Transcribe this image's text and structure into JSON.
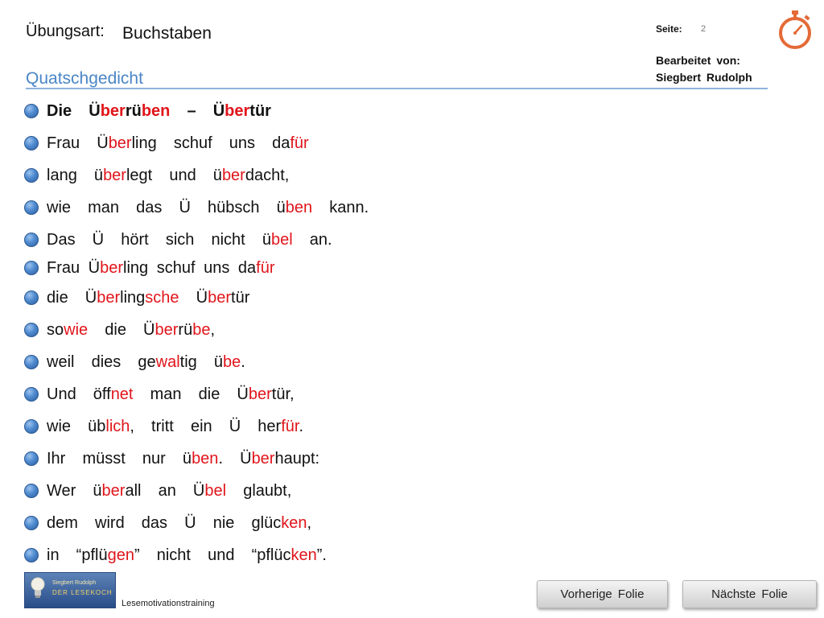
{
  "header": {
    "label": "Übungsart:",
    "value": "Buchstaben",
    "subtitle": "Quatschgedicht"
  },
  "meta": {
    "page_label": "Seite:",
    "page_number": "2",
    "editor_label": "Bearbeitet von:",
    "editor_name": "Siegbert Rudolph"
  },
  "colors": {
    "accent_red": "#e0151b",
    "subtitle_blue": "#4a86c6",
    "bullet_blue": "#4f8ad0"
  },
  "icons": {
    "timer": "stopwatch-icon",
    "bullet": "bullet-icon"
  },
  "poem": [
    {
      "bold": true,
      "segments": [
        {
          "t": "Die  Ü"
        },
        {
          "t": "ber",
          "red": true
        },
        {
          "t": "rü"
        },
        {
          "t": "ben",
          "red": true
        },
        {
          "t": "  –  Ü"
        },
        {
          "t": "ber",
          "red": true
        },
        {
          "t": "tür"
        }
      ]
    },
    {
      "segments": [
        {
          "t": "Frau  Ü"
        },
        {
          "t": "ber",
          "red": true
        },
        {
          "t": "ling  schuf  uns  da"
        },
        {
          "t": "für",
          "red": true
        }
      ]
    },
    {
      "segments": [
        {
          "t": "lang  ü"
        },
        {
          "t": "ber",
          "red": true
        },
        {
          "t": "legt  und  ü"
        },
        {
          "t": "ber",
          "red": true
        },
        {
          "t": "dacht,"
        }
      ]
    },
    {
      "segments": [
        {
          "t": "wie  man  das  Ü  hübsch  ü"
        },
        {
          "t": "ben",
          "red": true
        },
        {
          "t": "  kann."
        }
      ]
    },
    {
      "segments": [
        {
          "t": "Das  Ü  hört  sich  nicht  ü"
        },
        {
          "t": "bel",
          "red": true
        },
        {
          "t": "  an."
        }
      ]
    },
    {
      "segments": [
        {
          "t": "Frau Ü"
        },
        {
          "t": "ber",
          "red": true
        },
        {
          "t": "ling schuf uns da"
        },
        {
          "t": "für",
          "red": true
        }
      ]
    },
    {
      "segments": [
        {
          "t": "die  Ü"
        },
        {
          "t": "ber",
          "red": true
        },
        {
          "t": "ling"
        },
        {
          "t": "sche",
          "red": true
        },
        {
          "t": "  Ü"
        },
        {
          "t": "ber",
          "red": true
        },
        {
          "t": "tür"
        }
      ]
    },
    {
      "segments": [
        {
          "t": "so"
        },
        {
          "t": "wie",
          "red": true
        },
        {
          "t": "  die  Ü"
        },
        {
          "t": "ber",
          "red": true
        },
        {
          "t": "rü"
        },
        {
          "t": "be",
          "red": true
        },
        {
          "t": ","
        }
      ]
    },
    {
      "segments": [
        {
          "t": "weil  dies  ge"
        },
        {
          "t": "wal",
          "red": true
        },
        {
          "t": "tig  ü"
        },
        {
          "t": "be",
          "red": true
        },
        {
          "t": "."
        }
      ]
    },
    {
      "segments": [
        {
          "t": "Und  öff"
        },
        {
          "t": "net",
          "red": true
        },
        {
          "t": "  man  die  Ü"
        },
        {
          "t": "ber",
          "red": true
        },
        {
          "t": "tür,"
        }
      ]
    },
    {
      "segments": [
        {
          "t": "wie  üb"
        },
        {
          "t": "lich",
          "red": true
        },
        {
          "t": ",  tritt  ein  Ü  her"
        },
        {
          "t": "für",
          "red": true
        },
        {
          "t": "."
        }
      ]
    },
    {
      "segments": [
        {
          "t": "Ihr  müsst  nur  ü"
        },
        {
          "t": "ben",
          "red": true
        },
        {
          "t": ".  Ü"
        },
        {
          "t": "ber",
          "red": true
        },
        {
          "t": "haupt:"
        }
      ]
    },
    {
      "segments": [
        {
          "t": "Wer  ü"
        },
        {
          "t": "ber",
          "red": true
        },
        {
          "t": "all  an  Ü"
        },
        {
          "t": "bel",
          "red": true
        },
        {
          "t": "  glaubt,"
        }
      ]
    },
    {
      "segments": [
        {
          "t": "dem  wird  das  Ü  nie  glüc"
        },
        {
          "t": "ken",
          "red": true
        },
        {
          "t": ","
        }
      ]
    },
    {
      "segments": [
        {
          "t": "in  “pflü"
        },
        {
          "t": "gen",
          "red": true
        },
        {
          "t": "”  nicht  und  “pflüc"
        },
        {
          "t": "ken",
          "red": true
        },
        {
          "t": "”."
        }
      ]
    }
  ],
  "footer": {
    "logo_text_top": "Siegbert Rudolph",
    "logo_text_bottom": "DER LESEKOCH",
    "caption": "Lesemotivationstraining"
  },
  "nav": {
    "prev_label": "Vorherige  Folie",
    "next_label": "Nächste  Folie"
  }
}
